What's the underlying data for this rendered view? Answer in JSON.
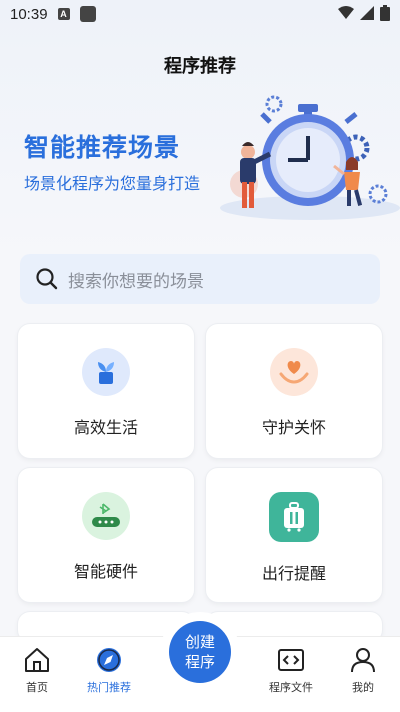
{
  "status_bar": {
    "time": "10:39",
    "app_badge": "A"
  },
  "page": {
    "title": "程序推荐"
  },
  "hero": {
    "title": "智能推荐场景",
    "subtitle": "场景化程序为您量身打造"
  },
  "search": {
    "placeholder": "搜索你想要的场景"
  },
  "cards": [
    {
      "label": "高效生活",
      "icon": "plant-pot-icon",
      "color": "#4a90f0"
    },
    {
      "label": "守护关怀",
      "icon": "heart-hands-icon",
      "color": "#f08a4b"
    },
    {
      "label": "智能硬件",
      "icon": "bluetooth-device-icon",
      "color": "#4cb86a"
    },
    {
      "label": "出行提醒",
      "icon": "luggage-icon",
      "color": "#3fb59a"
    }
  ],
  "bottom_nav": {
    "items": [
      {
        "label": "首页",
        "icon": "home-icon"
      },
      {
        "label": "热门推荐",
        "icon": "compass-icon",
        "active": true
      },
      {
        "label": "程序文件",
        "icon": "code-file-icon"
      },
      {
        "label": "我的",
        "icon": "profile-icon"
      }
    ],
    "fab": {
      "line1": "创建",
      "line2": "程序"
    }
  },
  "colors": {
    "accent": "#2a6fdc"
  }
}
